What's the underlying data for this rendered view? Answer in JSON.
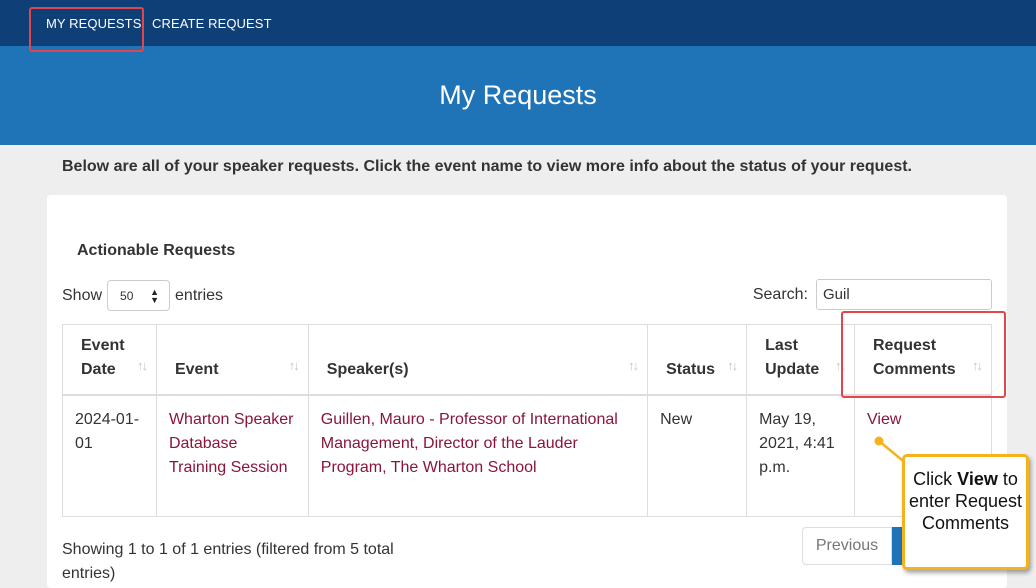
{
  "nav": {
    "my_requests": "MY REQUESTS",
    "create_request": "CREATE REQUEST"
  },
  "hero": {
    "title": "My Requests"
  },
  "intro": "Below are all of your speaker requests. Click the event name to view more info about the status of your request.",
  "section": {
    "title": "Actionable Requests",
    "show_label": "Show",
    "entries_value": "50",
    "entries_label": "entries",
    "search_label": "Search:",
    "search_value": "Guil"
  },
  "table": {
    "columns": [
      {
        "line1": "Event",
        "line2": "Date"
      },
      {
        "line1": "",
        "line2": "Event"
      },
      {
        "line1": "",
        "line2": "Speaker(s)"
      },
      {
        "line1": "",
        "line2": "Status"
      },
      {
        "line1": "Last",
        "line2": "Update"
      },
      {
        "line1": "Request",
        "line2": "Comments"
      }
    ],
    "rows": [
      {
        "date": "2024-01-01",
        "event": "Wharton Speaker Database Training Session",
        "speaker": "Guillen, Mauro - Professor of International Management, Director of the Lauder Program, The Wharton School",
        "status": "New",
        "last_update": "May 19, 2021, 4:41 p.m.",
        "comments": "View"
      }
    ]
  },
  "footer": {
    "info": "Showing 1 to 1 of 1 entries (filtered from 5 total entries)",
    "previous": "Previous"
  },
  "callout": {
    "pre": "Click ",
    "bold": "View",
    "post": " to enter Request Comments"
  },
  "colors": {
    "nav": "#0f3f77",
    "hero": "#1f73b7",
    "link": "#8a1538",
    "highlight": "#e0474c",
    "callout_border": "#f5b21f"
  }
}
